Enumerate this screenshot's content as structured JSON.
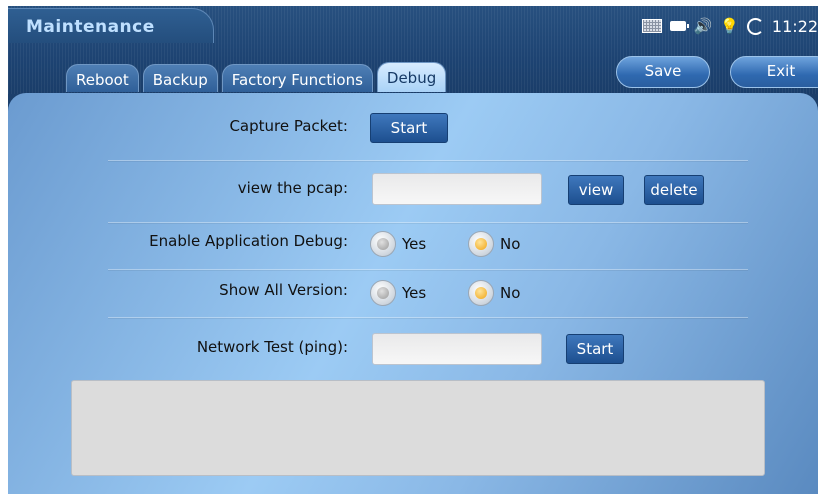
{
  "app": {
    "title": "Maintenance"
  },
  "status": {
    "time": "11:22",
    "icons": [
      "keyboard-icon",
      "battery-icon",
      "volume-icon",
      "bulb-icon",
      "sync-icon"
    ]
  },
  "tabs": [
    {
      "label": "Reboot",
      "active": false
    },
    {
      "label": "Backup",
      "active": false
    },
    {
      "label": "Factory Functions",
      "active": false
    },
    {
      "label": "Debug",
      "active": true
    }
  ],
  "actions": {
    "save": "Save",
    "exit": "Exit"
  },
  "debug": {
    "capture": {
      "label": "Capture Packet:",
      "button": "Start"
    },
    "pcap": {
      "label": "view the pcap:",
      "value": "",
      "view_button": "view",
      "delete_button": "delete"
    },
    "app_debug": {
      "label": "Enable Application Debug:",
      "yes": "Yes",
      "no": "No",
      "selected": "No"
    },
    "show_version": {
      "label": "Show All Version:",
      "yes": "Yes",
      "no": "No",
      "selected": "No"
    },
    "network_test": {
      "label": "Network Test (ping):",
      "value": "",
      "button": "Start"
    },
    "output": ""
  },
  "colors": {
    "accent": "#2f69b0",
    "panel": "#9ccbf4",
    "radio_selected": "#f0a414"
  }
}
